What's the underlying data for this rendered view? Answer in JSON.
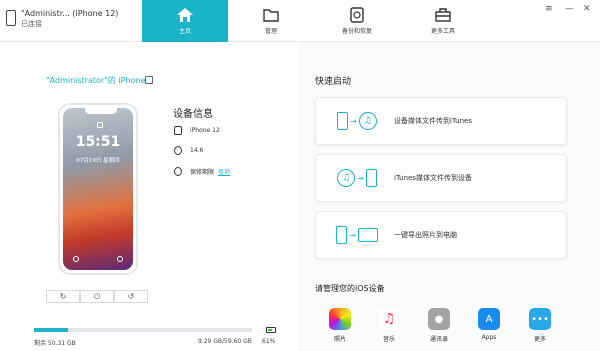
{
  "titlebar": {
    "device_name": "\"Administr... (iPhone 12)",
    "device_status": "已连接",
    "window_controls": {
      "menu": "≡",
      "minimize": "—",
      "close": "✕"
    }
  },
  "nav": [
    {
      "label": "主页",
      "icon": "home-icon",
      "active": true
    },
    {
      "label": "管理",
      "icon": "folder-icon",
      "active": false
    },
    {
      "label": "备份和恢复",
      "icon": "backup-icon",
      "active": false
    },
    {
      "label": "更多工具",
      "icon": "toolbox-icon",
      "active": false
    }
  ],
  "device": {
    "title": "\"Administrator\"的 iPhone",
    "lock_time": "15:51",
    "lock_date": "07月19日 星期四",
    "info_heading": "设备信息",
    "model": "iPhone 12",
    "ios_version": "14.6",
    "warranty_label": "保修期限",
    "warranty_link": "查询"
  },
  "storage": {
    "free": "剩余 50.31 GB",
    "used": "9.29 GB/59.60 GB",
    "fill_fraction": 0.156,
    "battery": "61%"
  },
  "quick_start": {
    "title": "快速启动",
    "cards": [
      {
        "label": "设备媒体文件传到iTunes"
      },
      {
        "label": "iTunes媒体文件传到设备"
      },
      {
        "label": "一键导出照片到电脑"
      }
    ]
  },
  "ios_manage": {
    "title": "请管理您的iOS设备",
    "apps": [
      {
        "label": "照片",
        "icon": "photos-icon",
        "color": "#f5a623"
      },
      {
        "label": "音乐",
        "icon": "music-icon",
        "color": "#fc3d5a"
      },
      {
        "label": "通讯录",
        "icon": "contacts-icon",
        "color": "#a3a3a3"
      },
      {
        "label": "Apps",
        "icon": "appstore-icon",
        "color": "#1a8cf0"
      },
      {
        "label": "更多",
        "icon": "more-icon",
        "color": "#2aa7e8"
      }
    ]
  },
  "colors": {
    "accent": "#1bb3c7"
  }
}
